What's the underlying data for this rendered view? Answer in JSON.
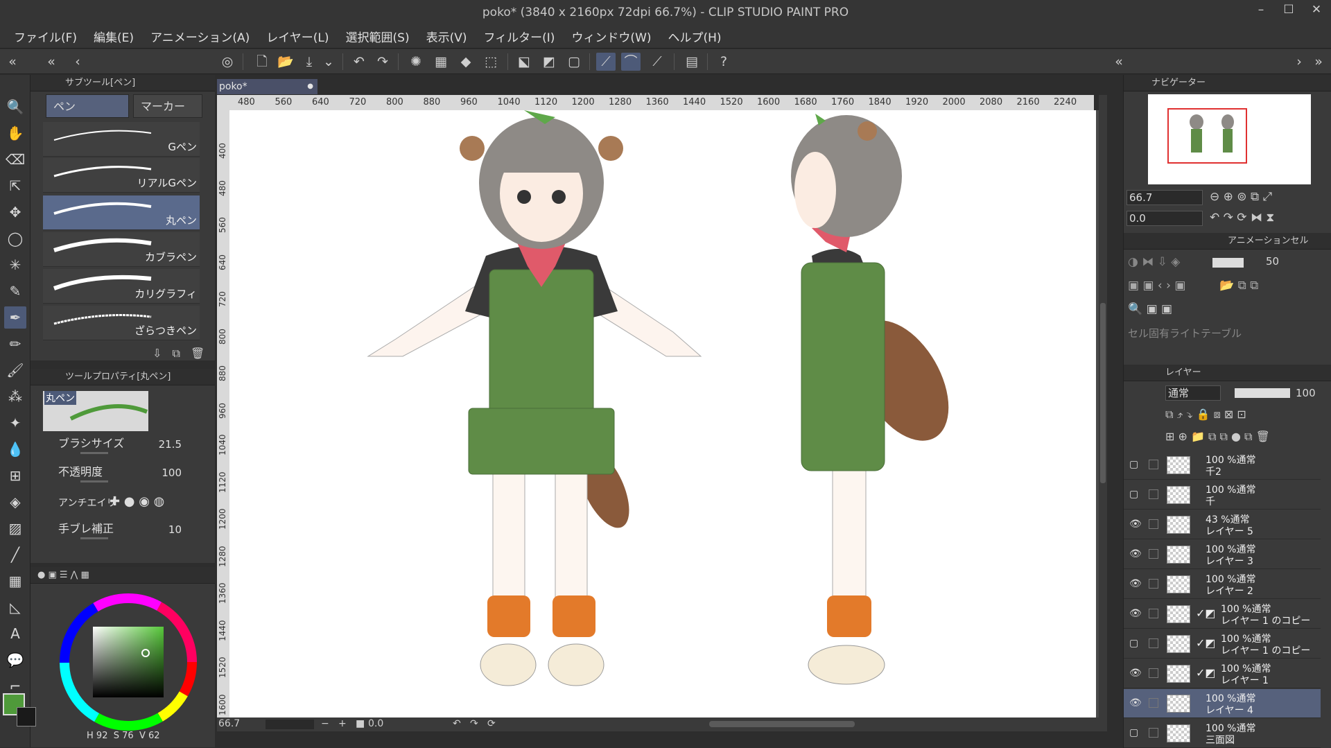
{
  "window": {
    "title": "poko* (3840 x 2160px 72dpi 66.7%)  - CLIP STUDIO PAINT PRO"
  },
  "menu": [
    "ファイル(F)",
    "編集(E)",
    "アニメーション(A)",
    "レイヤー(L)",
    "選択範囲(S)",
    "表示(V)",
    "フィルター(I)",
    "ウィンドウ(W)",
    "ヘルプ(H)"
  ],
  "subtool": {
    "panel_title": "サブツール[ペン]",
    "group_tabs": [
      "ペン",
      "マーカー"
    ],
    "brushes": [
      "Gペン",
      "リアルGペン",
      "丸ペン",
      "カブラペン",
      "カリグラフィ",
      "ざらつきペン"
    ],
    "active_brush": "丸ペン"
  },
  "tool_property": {
    "panel_title": "ツールプロパティ[丸ペン]",
    "preview_label": "丸ペン",
    "brush_size_label": "ブラシサイズ",
    "brush_size": "21.5",
    "opacity_label": "不透明度",
    "opacity": "100",
    "antialias_label": "アンチエイリ",
    "stabilization_label": "手ブレ補正",
    "stabilization": "10"
  },
  "color": {
    "main": "#4f9a3a",
    "sub": "#1a1a1a",
    "h": "92",
    "s": "76",
    "v": "62",
    "h_label": "H",
    "s_label": "S",
    "v_label": "V"
  },
  "document": {
    "tab": "poko*",
    "ruler_h": [
      "480",
      "560",
      "640",
      "720",
      "800",
      "880",
      "960",
      "1040",
      "1120",
      "1200",
      "1280",
      "1360",
      "1440",
      "1520",
      "1600",
      "1680",
      "1760",
      "1840",
      "1920",
      "2000",
      "2080",
      "2160",
      "2240"
    ],
    "ruler_v": [
      "400",
      "480",
      "560",
      "640",
      "720",
      "800",
      "880",
      "960",
      "1040",
      "1120",
      "1200",
      "1280",
      "1360",
      "1440",
      "1520",
      "1600"
    ],
    "zoom": "66.7",
    "rotation": "0.0"
  },
  "navigator": {
    "title": "ナビゲーター",
    "zoom": "66.7",
    "rotation": "0.0"
  },
  "animation_cel": {
    "title": "アニメーションセル",
    "opacity": "50",
    "light_table_label": "セル固有ライトテーブル"
  },
  "layers": {
    "title": "レイヤー",
    "blend_mode": "通常",
    "opacity": "100",
    "items": [
      {
        "percent": "100 %通常",
        "name": "千2",
        "visible": false,
        "mask": false,
        "active": false
      },
      {
        "percent": "100 %通常",
        "name": "千",
        "visible": false,
        "mask": false,
        "active": false
      },
      {
        "percent": "43 %通常",
        "name": "レイヤー 5",
        "visible": true,
        "mask": false,
        "active": false
      },
      {
        "percent": "100 %通常",
        "name": "レイヤー 3",
        "visible": true,
        "mask": false,
        "active": false
      },
      {
        "percent": "100 %通常",
        "name": "レイヤー 2",
        "visible": true,
        "mask": false,
        "active": false
      },
      {
        "percent": "100 %通常",
        "name": "レイヤー 1 のコピー",
        "visible": true,
        "mask": true,
        "active": false
      },
      {
        "percent": "100 %通常",
        "name": "レイヤー 1 のコピー",
        "visible": false,
        "mask": true,
        "active": false
      },
      {
        "percent": "100 %通常",
        "name": "レイヤー 1",
        "visible": true,
        "mask": true,
        "active": false
      },
      {
        "percent": "100 %通常",
        "name": "レイヤー 4",
        "visible": true,
        "mask": false,
        "active": true
      },
      {
        "percent": "100 %通常",
        "name": "三面図",
        "visible": false,
        "mask": false,
        "active": false
      }
    ]
  }
}
